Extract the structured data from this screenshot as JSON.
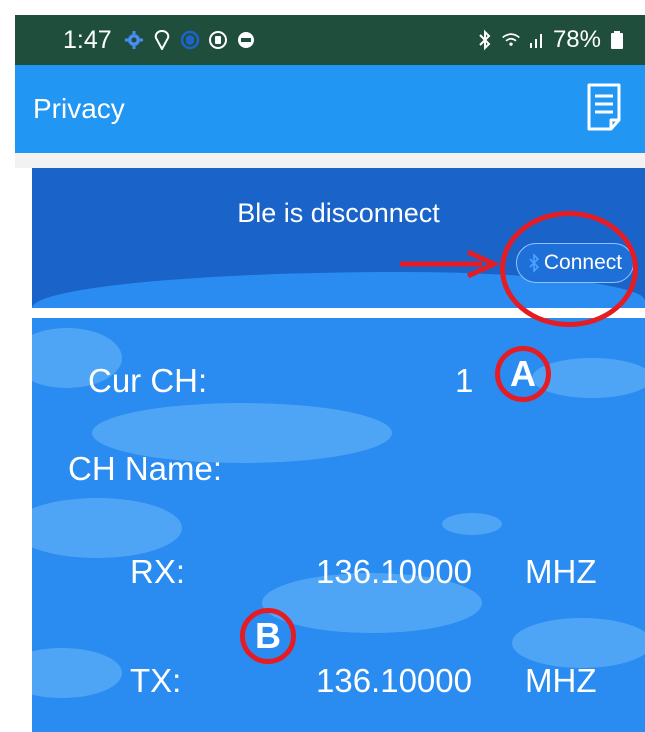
{
  "status_bar": {
    "time": "1:47",
    "battery": "78%",
    "icons": [
      "settings-gear-icon",
      "location-pin-icon",
      "shield-icon",
      "security-badge-icon",
      "app-icon",
      "bluetooth-icon",
      "wifi-icon",
      "signal-icon",
      "battery-icon"
    ]
  },
  "app_bar": {
    "title": "Privacy",
    "action_icon": "notes-icon"
  },
  "ble": {
    "status_text": "Ble is disconnect",
    "connect_label": "Connect"
  },
  "channel": {
    "cur_ch_label": "Cur CH:",
    "cur_ch_value": "1",
    "ch_name_label": "CH Name:",
    "ch_name_value": "",
    "rx_label": "RX:",
    "rx_value": "136.10000",
    "rx_unit": "MHZ",
    "tx_label": "TX:",
    "tx_value": "136.10000",
    "tx_unit": "MHZ"
  },
  "annotations": {
    "marker_a": "A",
    "marker_b": "B",
    "color": "#e51c23"
  },
  "colors": {
    "status_bar": "#1f4e3d",
    "app_bar": "#2196f3",
    "ble_panel": "#1a63c8",
    "channel_panel": "#2a8bf0"
  }
}
